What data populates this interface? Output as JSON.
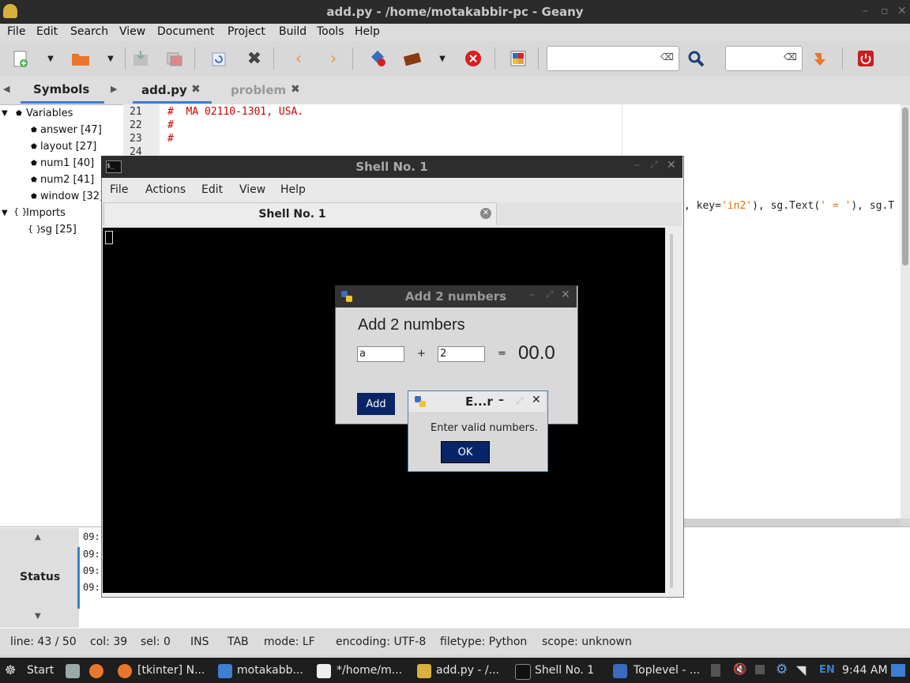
{
  "geany": {
    "title": "add.py - /home/motakabbir-pc - Geany",
    "menu": [
      "File",
      "Edit",
      "Search",
      "View",
      "Document",
      "Project",
      "Build",
      "Tools",
      "Help"
    ],
    "sidebar_tab": "Symbols",
    "tree": {
      "variables_label": "Variables",
      "variables": [
        "answer [47]",
        "layout [27]",
        "num1 [40]",
        "num2 [41]",
        "window [32]"
      ],
      "imports_label": "Imports",
      "imports": [
        "sg [25]"
      ]
    },
    "tabs": [
      "add.py",
      "problem"
    ],
    "line_numbers": [
      "21",
      "22",
      "23",
      "24"
    ],
    "code_lines": [
      "#  MA 02110-1301, USA.",
      "#",
      "#"
    ],
    "code_fragment": {
      "p1": ", key=",
      "s1": "'in2'",
      "p2": "), sg.Text(",
      "s2": "' = '",
      "p3": "), sg.T"
    },
    "msg_tab": "Status",
    "msg_times": [
      "09:",
      "09:",
      "09:",
      "09:"
    ],
    "status": {
      "line": "line: 43 / 50",
      "col": "col: 39",
      "sel": "sel: 0",
      "ins": "INS",
      "tab": "TAB",
      "mode": "mode: LF",
      "encoding": "encoding: UTF-8",
      "filetype": "filetype: Python",
      "scope": "scope: unknown"
    }
  },
  "shell": {
    "title": "Shell No. 1",
    "menu": [
      "File",
      "Actions",
      "Edit",
      "View",
      "Help"
    ],
    "tab": "Shell No. 1"
  },
  "add_dialog": {
    "title": "Add 2 numbers",
    "heading": "Add 2 numbers",
    "in1": "a",
    "plus": "+",
    "in2": "2",
    "eq": "=",
    "result": "00.0",
    "add_button": "Add"
  },
  "error_dialog": {
    "title": "E...r",
    "message": "Enter valid numbers.",
    "ok": "OK"
  },
  "taskbar": {
    "start": "Start",
    "items": [
      "[tkinter] N...",
      "motakabb...",
      "*/home/m...",
      "add.py - /...",
      "Shell No. 1",
      "Toplevel - ..."
    ],
    "lang": "EN",
    "clock": "9:44 AM"
  },
  "colors": {
    "dialog_button": "#082567",
    "comment_red": "#cc0000",
    "string_orange": "#e07000",
    "tab_active_underline": "#3d7fd0"
  }
}
